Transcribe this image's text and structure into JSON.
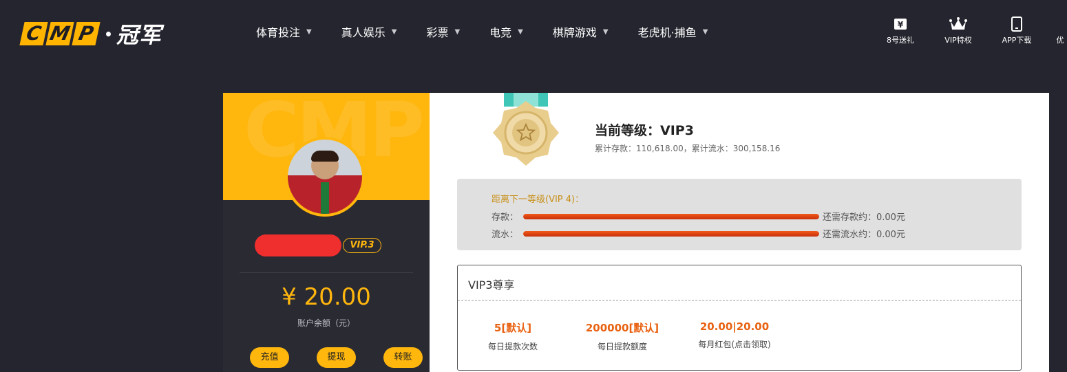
{
  "header": {
    "logo_letters": [
      "C",
      "M",
      "P"
    ],
    "logo_cn": "冠军",
    "nav": [
      {
        "label": "体育投注"
      },
      {
        "label": "真人娱乐"
      },
      {
        "label": "彩票"
      },
      {
        "label": "电竞"
      },
      {
        "label": "棋牌游戏"
      },
      {
        "label": "老虎机·捕鱼"
      }
    ],
    "right_icons": [
      {
        "label": "8号送礼",
        "icon": "yen-ticket-icon"
      },
      {
        "label": "VIP特权",
        "icon": "crown-icon"
      },
      {
        "label": "APP下载",
        "icon": "phone-icon"
      },
      {
        "label": "优",
        "icon": "none"
      }
    ]
  },
  "user_panel": {
    "watermark": "CMP",
    "vip_badge": "VIP.3",
    "balance": "¥ 20.00",
    "balance_label": "账户余额（元）",
    "actions": [
      "充值",
      "提现",
      "转账"
    ]
  },
  "vip_info": {
    "current_level": "当前等级：VIP3",
    "stats": "累计存款：110,618.00，累计流水：300,158.16",
    "next_level_title": "距离下一等级(VIP 4)：",
    "deposit": {
      "label": "存款：",
      "progress": 1.0,
      "need": "还需存款约：0.00元"
    },
    "turnover": {
      "label": "流水：",
      "progress": 1.0,
      "need": "还需流水约：0.00元"
    }
  },
  "privileges": {
    "title": "VIP3尊享",
    "items": [
      {
        "value": "5[默认]",
        "label": "每日提款次数"
      },
      {
        "value": "200000[默认]",
        "label": "每日提款额度"
      },
      {
        "value": "20.00|20.00",
        "label": "每月红包(点击领取)"
      }
    ]
  },
  "colors": {
    "accent": "#ffb60d",
    "header_bg": "#25252f",
    "progress": "#e04a12",
    "privilege_value": "#e86212"
  }
}
